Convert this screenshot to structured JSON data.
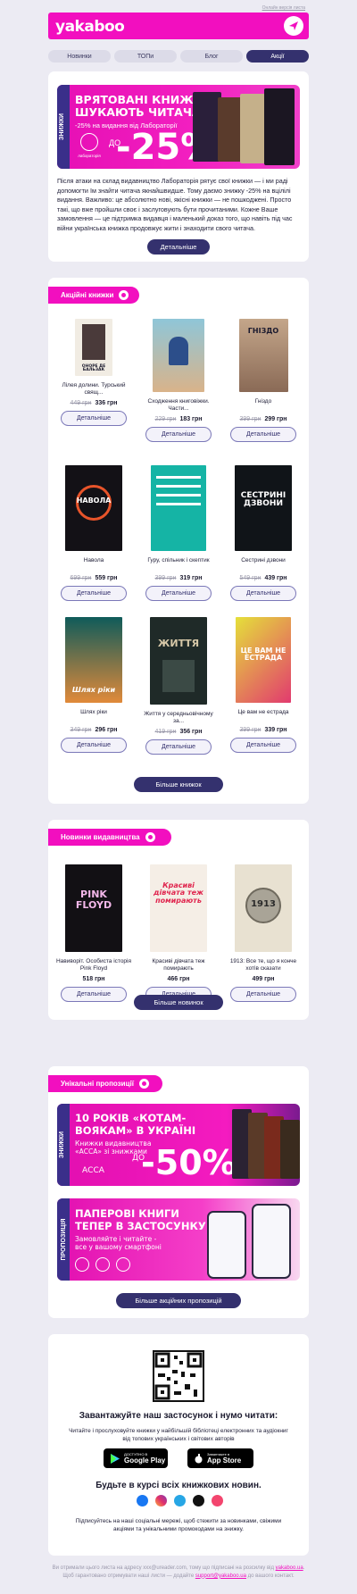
{
  "toplink": "Онлайн версія листа",
  "header": {
    "logo": "yakaboo",
    "icon": "plane-icon"
  },
  "nav": {
    "tabs": [
      "Новинки",
      "ТОПи",
      "Блог",
      "Акції"
    ],
    "active": 3
  },
  "promo1": {
    "vertical_tag": "ЗНИЖКИ",
    "title": [
      "ВРЯТОВАНІ КНИЖКИ",
      "ШУКАЮТЬ ЧИТАЧА"
    ],
    "subtitle": "-25% на видання від Лабораторії",
    "publisher": "лабораторія",
    "do": "ДО",
    "discount": "-25%",
    "text": "Після атаки на склад видавництво Лабораторія рятує свої книжки — і ми раді допомогти їм знайти читача якнайшвидше. Тому даємо знижку -25% на вцілілі видання. Важливо: це абсолютно нові, якісні книжки — не пошкоджені. Просто такі, що вже пройшли своє і заслуговують бути прочитаними. Кожне Ваше замовлення — це підтримка видавця і маленький доказ того, що навіть під час війни українська книжка продовжує жити і знаходити свого читача.",
    "button": "Детальніше"
  },
  "sale_books": {
    "tag": "Акційні книжки",
    "items": [
      {
        "title": "Лілея долини. Турський свящ...",
        "old": "449 грн",
        "price": "336 грн",
        "cover_text": "ОНОРЕ ДЕ БАЛЬЗАК"
      },
      {
        "title": "Сходження книговіжки. Части...",
        "old": "229 грн",
        "price": "183 грн",
        "cover_text": ""
      },
      {
        "title": "Гніздо",
        "old": "399 грн",
        "price": "299 грн",
        "cover_text": "ГНІЗДО"
      },
      {
        "title": "Навола",
        "old": "699 грн",
        "price": "559 грн",
        "cover_text": "НАВОЛА"
      },
      {
        "title": "Гуру, спільник і скептик",
        "old": "399 грн",
        "price": "319 грн",
        "cover_text": ""
      },
      {
        "title": "Сестрині дзвони",
        "old": "549 грн",
        "price": "439 грн",
        "cover_text": "СЕСТРИНІ ДЗВОНИ"
      },
      {
        "title": "Шлях ріки",
        "old": "349 грн",
        "price": "296 грн",
        "cover_text": "Шлях ріки"
      },
      {
        "title": "Життя у середньовічному за...",
        "old": "419 грн",
        "price": "356 грн",
        "cover_text": "ЖИТТЯ"
      },
      {
        "title": "Це вам не естрада",
        "old": "399 грн",
        "price": "339 грн",
        "cover_text": "ЦЕ ВАМ НЕ ЕСТРАДА"
      }
    ],
    "button_label": "Детальніше",
    "more": "Більше книжок"
  },
  "new_books": {
    "tag": "Новинки видавництва",
    "items": [
      {
        "title": "Навиворіт. Особиста історія Pink Floyd",
        "price": "518 грн",
        "cover_text": "PINK FLOYD"
      },
      {
        "title": "Красиві дівчата теж помирають",
        "price": "466 грн",
        "cover_text": "Красиві дівчата теж помирають"
      },
      {
        "title": "1913: Все те, що я конче хотів сказати",
        "price": "499 грн",
        "cover_text": "1913"
      }
    ],
    "button_label": "Детальніше",
    "more": "Більше новинок"
  },
  "unique": {
    "tag": "Унікальні пропозиції",
    "banner1": {
      "vertical_tag": "ЗНИЖКИ",
      "title": [
        "10 РОКІВ «КОТАМ-",
        "ВОЯКАМ» В УКРАЇНІ"
      ],
      "sub": [
        "Книжки видавництва",
        "«АССА» зі знижками"
      ],
      "publisher": "АССА",
      "do": "ДО",
      "discount": "-50%"
    },
    "banner2": {
      "vertical_tag": "ПРОПОЗИЦІЯ",
      "title": [
        "ПАПЕРОВІ КНИГИ",
        "ТЕПЕР В ЗАСТОСУНКУ"
      ],
      "sub": [
        "Замовляйте і читайте -",
        "все у вашому смартфоні"
      ]
    },
    "more": "Більше акційних пропозицій"
  },
  "app": {
    "title": "Завантажуйте наш застосунок і нумо читати:",
    "text": "Читайте і прослуховуйте книжки у найбільшій бібліотеці електронних та аудіокниг від топових українських і світових авторів",
    "google_small": "ДОСТУПНО В",
    "google_big": "Google Play",
    "apple_small": "Завантажте в",
    "apple_big": "App Store",
    "news_title": "Будьте в курсі всіх книжкових новин.",
    "news_text": "Підписуйтесь на наші соціальні мережі, щоб стежити за новинками, свіжими акціями та унікальними промокодами на знижку."
  },
  "footer": {
    "line1": "Ви отримали цього листа на адресу xxx@ureader.com, тому що підписані на розсилку від",
    "link1": "yakaboo.ua",
    "line2": "Щоб гарантовано отримувати наші листи — додайте",
    "link2": "support@yakaboo.ua",
    "line3": "до вашого контакт."
  },
  "colors": {
    "brand": "#f20fbf",
    "navy": "#34316e",
    "bg": "#ecebf3"
  }
}
